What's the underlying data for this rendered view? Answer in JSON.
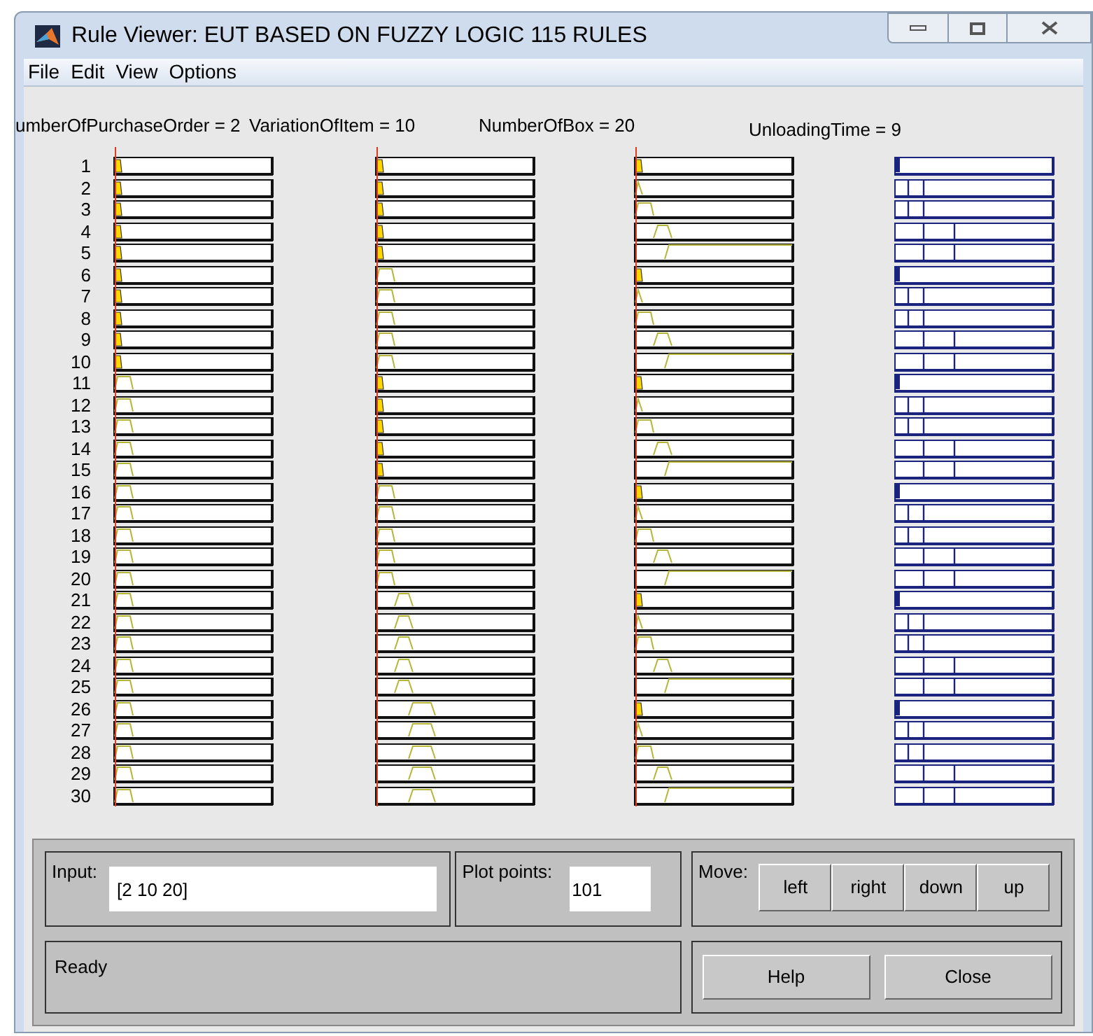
{
  "window": {
    "title": "Rule Viewer: EUT BASED ON FUZZY LOGIC 115 RULES"
  },
  "menu": [
    "File",
    "Edit",
    "View",
    "Options"
  ],
  "variables": [
    {
      "label": "umberOfPurchaseOrder = 2",
      "kind": "input"
    },
    {
      "label": "VariationOfItem = 10",
      "kind": "input"
    },
    {
      "label": "NumberOfBox = 20",
      "kind": "input"
    },
    {
      "label": "UnloadingTime = 9",
      "kind": "output"
    }
  ],
  "rules": [
    "1",
    "2",
    "3",
    "4",
    "5",
    "6",
    "7",
    "8",
    "9",
    "10",
    "11",
    "12",
    "13",
    "14",
    "15",
    "16",
    "17",
    "18",
    "19",
    "20",
    "21",
    "22",
    "23",
    "24",
    "25",
    "26",
    "27",
    "28",
    "29",
    "30"
  ],
  "input": {
    "label": "Input:",
    "value": "[2 10 20]"
  },
  "plot_points": {
    "label": "Plot points:",
    "value": "101"
  },
  "move": {
    "label": "Move:",
    "buttons": [
      "left",
      "right",
      "down",
      "up"
    ]
  },
  "status": "Ready",
  "buttons": [
    "Help",
    "Close"
  ]
}
